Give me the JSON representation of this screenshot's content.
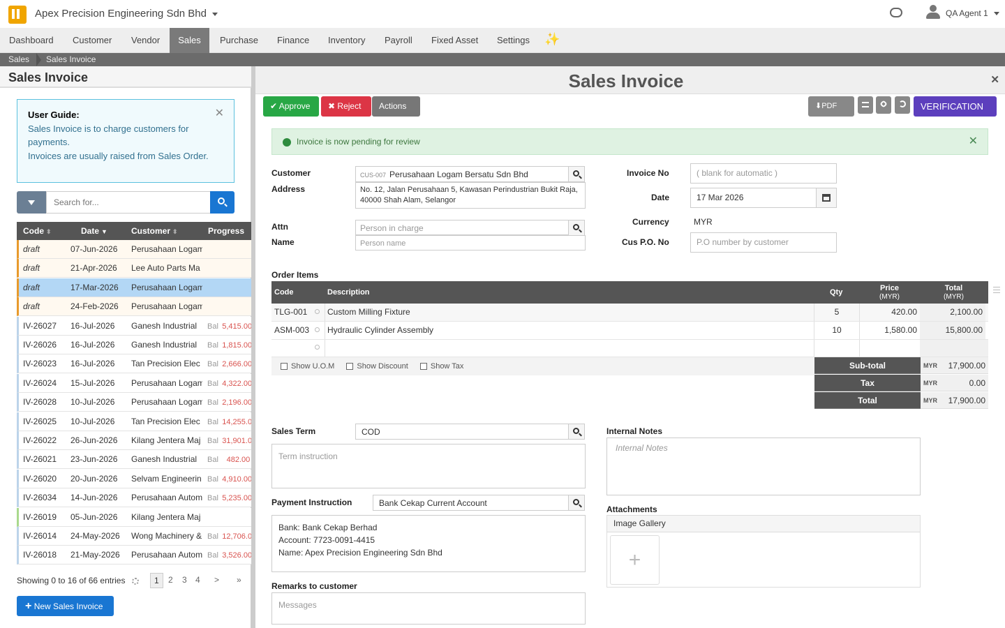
{
  "app": {
    "company": "Apex Precision Engineering Sdn Bhd",
    "user": "QA Agent 1"
  },
  "nav": {
    "items": [
      "Dashboard",
      "Customer",
      "Vendor",
      "Sales",
      "Purchase",
      "Finance",
      "Inventory",
      "Payroll",
      "Fixed Asset",
      "Settings"
    ],
    "active": "Sales"
  },
  "breadcrumb": [
    "Sales",
    "Sales Invoice"
  ],
  "left": {
    "title": "Sales Invoice",
    "guide_title": "User Guide:",
    "guide_line1": "Sales Invoice is to charge customers for payments.",
    "guide_line2": "Invoices are usually raised from Sales Order.",
    "search_placeholder": "Search for...",
    "columns": [
      "Code",
      "Date",
      "Customer",
      "Progress"
    ],
    "rows": [
      {
        "code": "draft",
        "date": "07-Jun-2026",
        "customer": "Perusahaan Logam",
        "bal": "",
        "val": "",
        "type": "draft"
      },
      {
        "code": "draft",
        "date": "21-Apr-2026",
        "customer": "Lee Auto Parts Ma",
        "bal": "",
        "val": "",
        "type": "draft"
      },
      {
        "code": "draft",
        "date": "17-Mar-2026",
        "customer": "Perusahaan Logam",
        "bal": "",
        "val": "",
        "type": "sel"
      },
      {
        "code": "draft",
        "date": "24-Feb-2026",
        "customer": "Perusahaan Logam",
        "bal": "",
        "val": "",
        "type": "draft"
      },
      {
        "code": "IV-26027",
        "date": "16-Jul-2026",
        "customer": "Ganesh Industrial",
        "bal": "Bal",
        "val": "5,415.00",
        "type": "inv"
      },
      {
        "code": "IV-26026",
        "date": "16-Jul-2026",
        "customer": "Ganesh Industrial",
        "bal": "Bal",
        "val": "1,815.00",
        "type": "inv"
      },
      {
        "code": "IV-26023",
        "date": "16-Jul-2026",
        "customer": "Tan Precision Elec",
        "bal": "Bal",
        "val": "2,666.00",
        "type": "inv"
      },
      {
        "code": "IV-26024",
        "date": "15-Jul-2026",
        "customer": "Perusahaan Logam",
        "bal": "Bal",
        "val": "4,322.00",
        "type": "inv"
      },
      {
        "code": "IV-26028",
        "date": "10-Jul-2026",
        "customer": "Perusahaan Logam",
        "bal": "Bal",
        "val": "2,196.00",
        "type": "inv"
      },
      {
        "code": "IV-26025",
        "date": "10-Jul-2026",
        "customer": "Tan Precision Elec",
        "bal": "Bal",
        "val": "14,255.00",
        "type": "inv"
      },
      {
        "code": "IV-26022",
        "date": "26-Jun-2026",
        "customer": "Kilang Jentera Maj",
        "bal": "Bal",
        "val": "31,901.00",
        "type": "inv"
      },
      {
        "code": "IV-26021",
        "date": "23-Jun-2026",
        "customer": "Ganesh Industrial",
        "bal": "Bal",
        "val": "482.00",
        "type": "inv"
      },
      {
        "code": "IV-26020",
        "date": "20-Jun-2026",
        "customer": "Selvam Engineerin",
        "bal": "Bal",
        "val": "4,910.00",
        "type": "inv"
      },
      {
        "code": "IV-26034",
        "date": "14-Jun-2026",
        "customer": "Perusahaan Autom",
        "bal": "Bal",
        "val": "5,235.00",
        "type": "inv"
      },
      {
        "code": "IV-26019",
        "date": "05-Jun-2026",
        "customer": "Kilang Jentera Maj",
        "bal": "",
        "val": "",
        "type": "green"
      },
      {
        "code": "IV-26014",
        "date": "24-May-2026",
        "customer": "Wong Machinery &",
        "bal": "Bal",
        "val": "12,706.00",
        "type": "inv"
      },
      {
        "code": "IV-26018",
        "date": "21-May-2026",
        "customer": "Perusahaan Autom",
        "bal": "Bal",
        "val": "3,526.00",
        "type": "inv"
      }
    ],
    "showing": "Showing 0 to 16 of 66 entries",
    "pages": [
      "1",
      "2",
      "3",
      "4",
      ">",
      "»"
    ],
    "new_button": "New Sales Invoice"
  },
  "invoice": {
    "title": "Sales Invoice",
    "buttons": {
      "approve": "Approve",
      "reject": "Reject",
      "actions": "Actions",
      "pdf": "PDF",
      "verification": "VERIFICATION"
    },
    "alert": "Invoice is now pending for review",
    "labels": {
      "customer": "Customer",
      "address": "Address",
      "attn": "Attn",
      "name": "Name",
      "invoice_no": "Invoice No",
      "date": "Date",
      "currency": "Currency",
      "cus_po": "Cus P.O. No",
      "order_items": "Order Items",
      "sales_term": "Sales Term",
      "payment_instruction": "Payment Instruction",
      "remarks": "Remarks to customer",
      "internal_notes": "Internal Notes",
      "attachments": "Attachments"
    },
    "customer_code": "CUS-007",
    "customer_name": "Perusahaan Logam Bersatu Sdn Bhd",
    "address_line1": "No. 12, Jalan Perusahaan 5, Kawasan Perindustrian Bukit Raja,",
    "address_line2": "40000 Shah Alam, Selangor",
    "attn_placeholder": "Person in charge",
    "name_placeholder": "Person name",
    "invoice_no_placeholder": "( blank for automatic )",
    "date": "17 Mar 2026",
    "currency": "MYR",
    "cus_po_placeholder": "P.O number by customer",
    "order_columns": {
      "code": "Code",
      "desc": "Description",
      "qty": "Qty",
      "price": "Price",
      "total": "Total",
      "unit": "(MYR)"
    },
    "items": [
      {
        "code": "TLG-001",
        "desc": "Custom Milling Fixture",
        "qty": "5",
        "price": "420.00",
        "total": "2,100.00"
      },
      {
        "code": "ASM-003",
        "desc": "Hydraulic Cylinder Assembly",
        "qty": "10",
        "price": "1,580.00",
        "total": "15,800.00"
      }
    ],
    "options": [
      "Show U.O.M",
      "Show Discount",
      "Show Tax"
    ],
    "totals": [
      {
        "label": "Sub-total",
        "cur": "MYR",
        "value": "17,900.00"
      },
      {
        "label": "Tax",
        "cur": "MYR",
        "value": "0.00"
      },
      {
        "label": "Total",
        "cur": "MYR",
        "value": "17,900.00"
      }
    ],
    "sales_term": "COD",
    "term_placeholder": "Term instruction",
    "payment_account": "Bank Cekap Current Account",
    "payment_lines": [
      "Bank: Bank Cekap Berhad",
      "Account: 7723-0091-4415",
      "Name: Apex Precision Engineering Sdn Bhd"
    ],
    "remarks_placeholder": "Messages",
    "internal_notes_placeholder": "Internal Notes",
    "gallery_title": "Image Gallery",
    "add_symbol": "+"
  }
}
